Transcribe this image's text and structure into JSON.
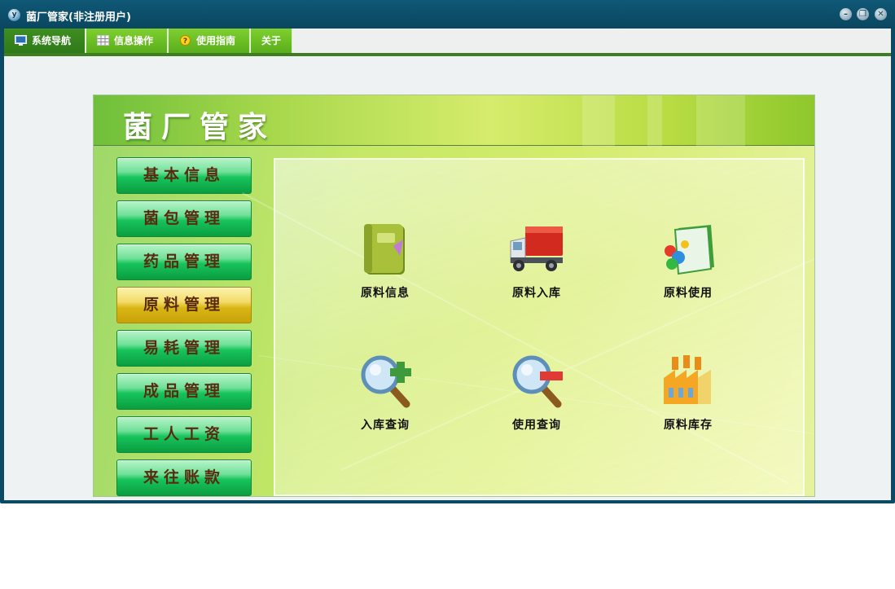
{
  "window": {
    "title": "菌厂管家(非注册用户)",
    "app_icon_letter": "y"
  },
  "menu": {
    "tabs": [
      {
        "label": "系统导航",
        "icon": "monitor-icon",
        "active": true
      },
      {
        "label": "信息操作",
        "icon": "grid-icon",
        "active": false
      },
      {
        "label": "使用指南",
        "icon": "help-icon",
        "active": false
      },
      {
        "label": "关于",
        "icon": "",
        "active": false
      }
    ]
  },
  "banner": {
    "title": "菌厂管家"
  },
  "sidebar": {
    "items": [
      {
        "label": "基本信息",
        "active": false
      },
      {
        "label": "菌包管理",
        "active": false
      },
      {
        "label": "药品管理",
        "active": false
      },
      {
        "label": "原料管理",
        "active": true
      },
      {
        "label": "易耗管理",
        "active": false
      },
      {
        "label": "成品管理",
        "active": false
      },
      {
        "label": "工人工资",
        "active": false
      },
      {
        "label": "来往账款",
        "active": false
      }
    ]
  },
  "tiles": [
    {
      "label": "原料信息",
      "icon": "book-icon"
    },
    {
      "label": "原料入库",
      "icon": "truck-icon"
    },
    {
      "label": "原料使用",
      "icon": "files-icon"
    },
    {
      "label": "入库查询",
      "icon": "magnifier-plus-icon"
    },
    {
      "label": "使用查询",
      "icon": "magnifier-minus-icon"
    },
    {
      "label": "原料库存",
      "icon": "factory-icon"
    }
  ],
  "colors": {
    "title_bar": "#0c4a63",
    "tab_green": "#6abf25",
    "active_button": "#e0bd1c",
    "side_button": "#18c45c"
  }
}
